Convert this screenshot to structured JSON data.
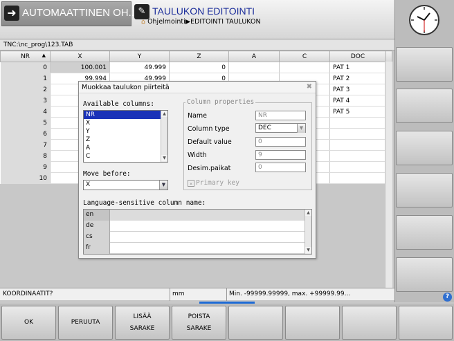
{
  "header": {
    "mode_primary": "AUTOMAATTINEN OH...",
    "mode_secondary": "TAULUKON EDITOINTI",
    "breadcrumb": "Ohjelmointi▶EDITOINTI TAULUKON"
  },
  "path": "TNC:\\nc_prog\\123.TAB",
  "table": {
    "columns": [
      "NR",
      "X",
      "Y",
      "Z",
      "A",
      "C",
      "DOC"
    ],
    "rows": [
      {
        "nr": "0",
        "x": "100.001",
        "y": "49.999",
        "z": "0",
        "a": "",
        "c": "",
        "doc": "PAT 1"
      },
      {
        "nr": "1",
        "x": "99.994",
        "y": "49.999",
        "z": "0",
        "a": "",
        "c": "",
        "doc": "PAT 2"
      },
      {
        "nr": "2",
        "x": "",
        "y": "",
        "z": "",
        "a": "",
        "c": "",
        "doc": "PAT 3"
      },
      {
        "nr": "3",
        "x": "",
        "y": "",
        "z": "",
        "a": "",
        "c": "",
        "doc": "PAT 4"
      },
      {
        "nr": "4",
        "x": "",
        "y": "",
        "z": "",
        "a": "",
        "c": "",
        "doc": "PAT 5"
      },
      {
        "nr": "5",
        "x": "",
        "y": "",
        "z": "",
        "a": "",
        "c": "",
        "doc": ""
      },
      {
        "nr": "6",
        "x": "",
        "y": "",
        "z": "",
        "a": "",
        "c": "",
        "doc": ""
      },
      {
        "nr": "7",
        "x": "",
        "y": "",
        "z": "",
        "a": "",
        "c": "",
        "doc": ""
      },
      {
        "nr": "8",
        "x": "",
        "y": "",
        "z": "",
        "a": "",
        "c": "",
        "doc": ""
      },
      {
        "nr": "9",
        "x": "",
        "y": "",
        "z": "",
        "a": "",
        "c": "",
        "doc": ""
      },
      {
        "nr": "10",
        "x": "",
        "y": "",
        "z": "",
        "a": "",
        "c": "",
        "doc": ""
      }
    ]
  },
  "dialog": {
    "title": "Muokkaa taulukon piirteitä",
    "available_columns_label": "Available columns:",
    "available_columns": [
      "NR",
      "X",
      "Y",
      "Z",
      "A",
      "C"
    ],
    "selected_column": "NR",
    "move_before_label": "Move before:",
    "move_before_value": "X",
    "props_legend": "Column properties",
    "name_label": "Name",
    "name_value": "NR",
    "column_type_label": "Column type",
    "column_type_value": "DEC",
    "default_value_label": "Default value",
    "default_value": "0",
    "width_label": "Width",
    "width_value": "9",
    "decimals_label": "Desim.paikat",
    "decimals_value": "0",
    "primary_key_label": "Primary key",
    "lang_label": "Language-sensitive column name:",
    "languages": [
      "en",
      "de",
      "cs",
      "fr"
    ]
  },
  "status": {
    "prompt": "KOORDINAATIT?",
    "unit": "mm",
    "range": "Min. -99999.99999, max. +99999.99..."
  },
  "softkeys": {
    "ok": "OK",
    "cancel": "PERUUTA",
    "add_line1": "LISÄÄ",
    "add_line2": "SARAKE",
    "remove_line1": "POISTA",
    "remove_line2": "SARAKE"
  },
  "colors": {
    "accent": "#1a32b8",
    "title_blue": "#1a2c9a",
    "page_indicator": "#1c6ad6"
  },
  "icons": [
    "program-run-icon",
    "table-edit-icon",
    "home-icon",
    "clock-icon",
    "close-icon",
    "help-icon",
    "sort-ascending-icon"
  ]
}
